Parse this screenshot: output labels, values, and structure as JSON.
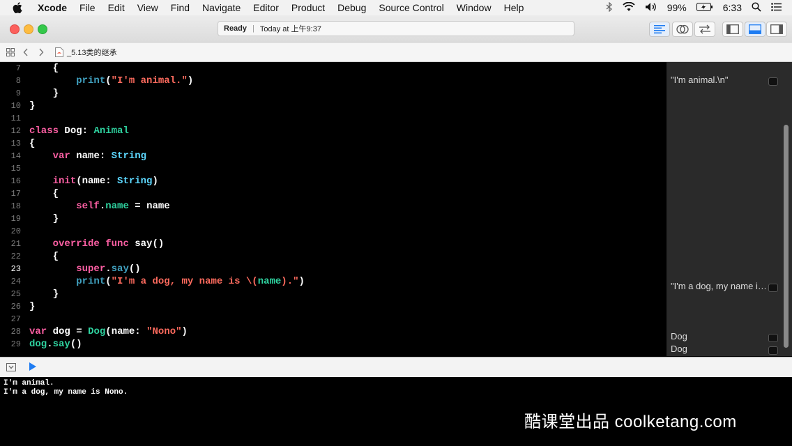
{
  "menubar": {
    "app": "Xcode",
    "items": [
      "File",
      "Edit",
      "View",
      "Find",
      "Navigate",
      "Editor",
      "Product",
      "Debug",
      "Source Control",
      "Window",
      "Help"
    ],
    "battery": "99%",
    "time": "6:33"
  },
  "toolbar": {
    "status": "Ready",
    "timestamp": "Today at 上午9:37"
  },
  "jumpbar": {
    "file": "_5.13类的继承"
  },
  "editor": {
    "current_line": "23",
    "lines": [
      {
        "num": "7"
      },
      {
        "num": "8"
      },
      {
        "num": "9"
      },
      {
        "num": "10"
      },
      {
        "num": "11"
      },
      {
        "num": "12"
      },
      {
        "num": "13"
      },
      {
        "num": "14"
      },
      {
        "num": "15"
      },
      {
        "num": "16"
      },
      {
        "num": "17"
      },
      {
        "num": "18"
      },
      {
        "num": "19"
      },
      {
        "num": "20"
      },
      {
        "num": "21"
      },
      {
        "num": "22"
      },
      {
        "num": "23"
      },
      {
        "num": "24"
      },
      {
        "num": "25"
      },
      {
        "num": "26"
      },
      {
        "num": "27"
      },
      {
        "num": "28"
      },
      {
        "num": "29"
      }
    ],
    "tokens": {
      "brace_open": "{",
      "brace_close": "}",
      "print": "print",
      "paren_open": "(",
      "paren_close": ")",
      "str_animal": "\"I'm animal.\"",
      "kw_class": "class",
      "dog": "Dog",
      "colon": ":",
      "animal": "Animal",
      "kw_var": "var",
      "name": "name",
      "ty_string": "String",
      "kw_init": "init",
      "kw_self": "self",
      "dot": ".",
      "eq": "=",
      "kw_override": "override",
      "kw_func": "func",
      "say": "say",
      "parens": "()",
      "kw_super": "super",
      "str_dog_a": "\"I'm a dog, my name is \\(",
      "str_dog_b": ").\"",
      "var_dog": "dog",
      "label_name": "name",
      "str_nono": "\"Nono\""
    }
  },
  "results": [
    {
      "text": "\"I'm animal.\\n\""
    },
    {
      "text": "\"I'm a dog, my name is Nono.\\n\""
    },
    {
      "text": "Dog"
    },
    {
      "text": "Dog"
    }
  ],
  "console": {
    "lines": [
      "I'm animal.",
      "I'm a dog, my name is Nono."
    ]
  },
  "watermark": "酷课堂出品 coolketang.com",
  "colors": {
    "keyword": "#fc5fa3",
    "type": "#5dd8ff",
    "class": "#2fd3a0",
    "string": "#fc6a5d",
    "accent": "#1e7cf2"
  }
}
